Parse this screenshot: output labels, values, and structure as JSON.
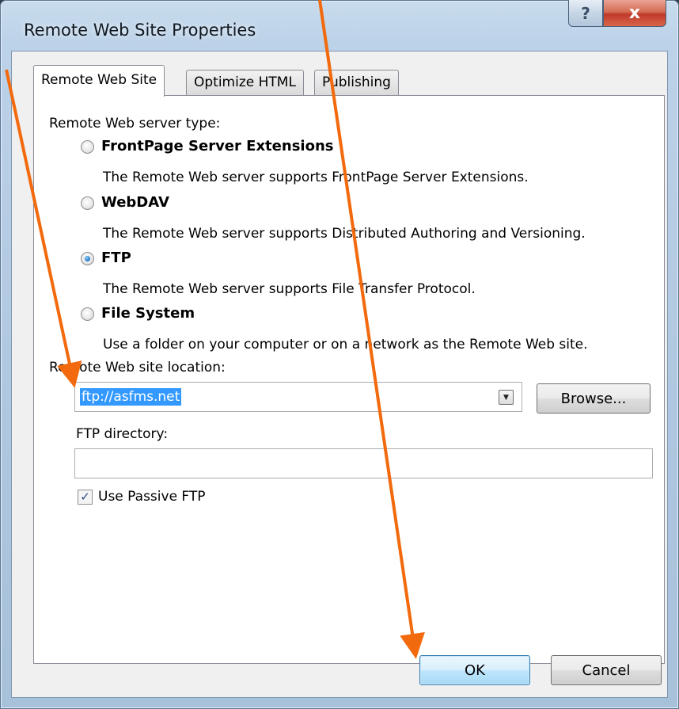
{
  "window": {
    "title": "Remote Web Site Properties"
  },
  "caption_buttons": {
    "help": "?",
    "close": "x"
  },
  "tabs": [
    {
      "label": "Remote Web Site",
      "active": true
    },
    {
      "label": "Optimize HTML",
      "active": false
    },
    {
      "label": "Publishing",
      "active": false
    }
  ],
  "server_type": {
    "label": "Remote Web server type:",
    "options": [
      {
        "title": "FrontPage Server Extensions",
        "description": "The Remote Web server supports FrontPage Server Extensions.",
        "selected": false
      },
      {
        "title": "WebDAV",
        "description": "The Remote Web server supports Distributed Authoring and Versioning.",
        "selected": false
      },
      {
        "title": "FTP",
        "description": "The Remote Web server supports File Transfer Protocol.",
        "selected": true
      },
      {
        "title": "File System",
        "description": "Use a folder on your computer or on a network as the Remote Web site.",
        "selected": false
      }
    ]
  },
  "location": {
    "label": "Remote Web site location:",
    "value": "ftp://asfms.net",
    "browse_label": "Browse..."
  },
  "ftp_directory": {
    "label": "FTP directory:",
    "value": ""
  },
  "passive_ftp": {
    "label": "Use Passive FTP",
    "checked": true
  },
  "footer": {
    "ok_label": "OK",
    "cancel_label": "Cancel"
  },
  "annotation_color": "#f26a0d"
}
